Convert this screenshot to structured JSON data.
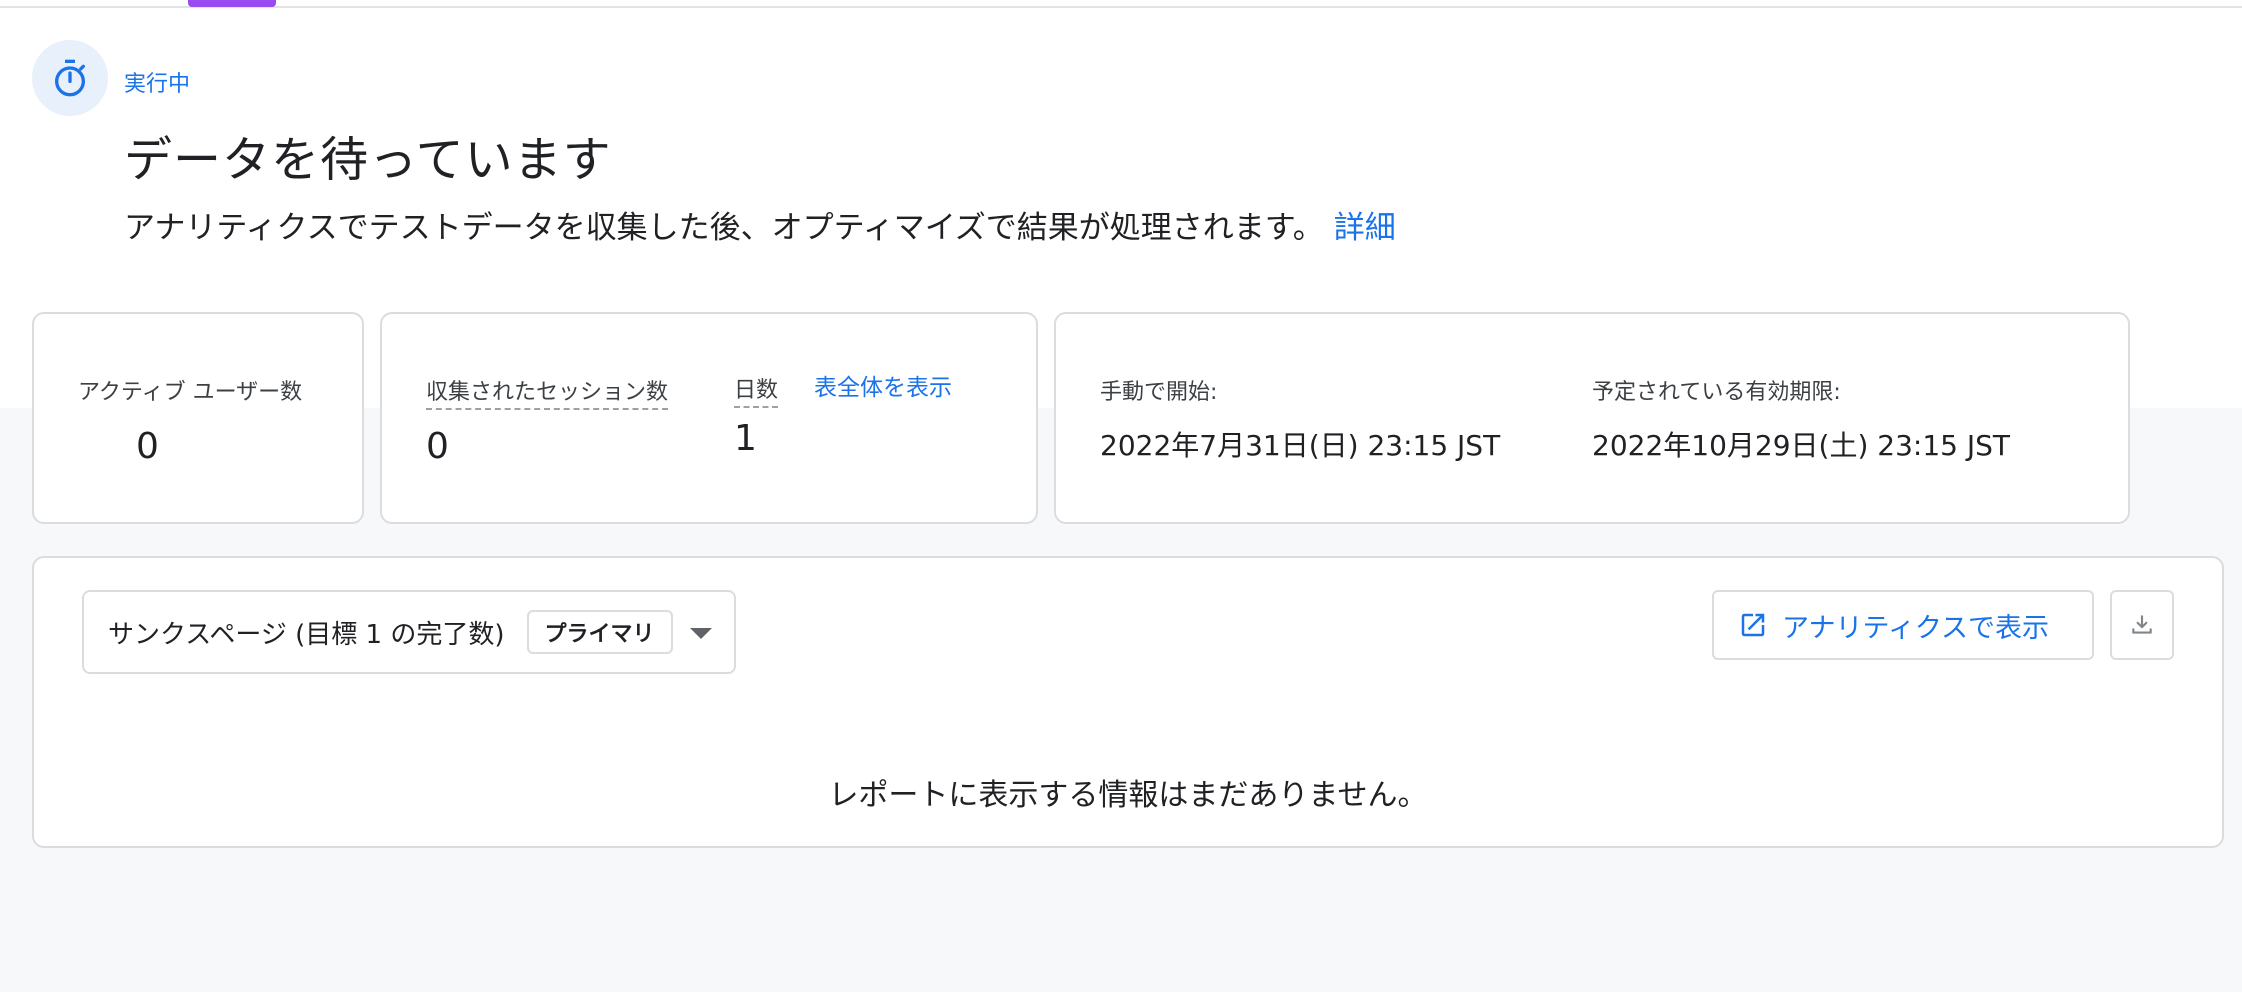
{
  "header": {
    "status_label": "実行中",
    "title": "データを待っています",
    "description": "アナリティクスでテストデータを収集した後、オプティマイズで結果が処理されます。",
    "learn_more_link": "詳細"
  },
  "stats": {
    "active_users_label": "アクティブ ユーザー数",
    "active_users_value": "0",
    "sessions_label": "収集されたセッション数",
    "sessions_value": "0",
    "days_label": "日数",
    "days_value": "1",
    "show_table_link": "表全体を表示",
    "started_label": "手動で開始:",
    "started_value": "2022年7月31日(日) 23:15 JST",
    "expires_label": "予定されている有効期限:",
    "expires_value": "2022年10月29日(土) 23:15 JST"
  },
  "report": {
    "goal_selector_value": "サンクスページ (目標 1 の完了数)",
    "primary_chip": "プライマリ",
    "view_in_analytics_button": "アナリティクスで表示",
    "empty_message": "レポートに表示する情報はまだありません。"
  },
  "colors": {
    "accent_blue": "#1a73e8",
    "tab_indicator": "#9a4bf0",
    "border": "#dadce0",
    "background_grey": "#f7f8fa"
  },
  "icons": {
    "status": "stopwatch-icon",
    "external_link": "open-in-new-icon",
    "download": "download-icon",
    "dropdown": "caret-down-icon"
  }
}
